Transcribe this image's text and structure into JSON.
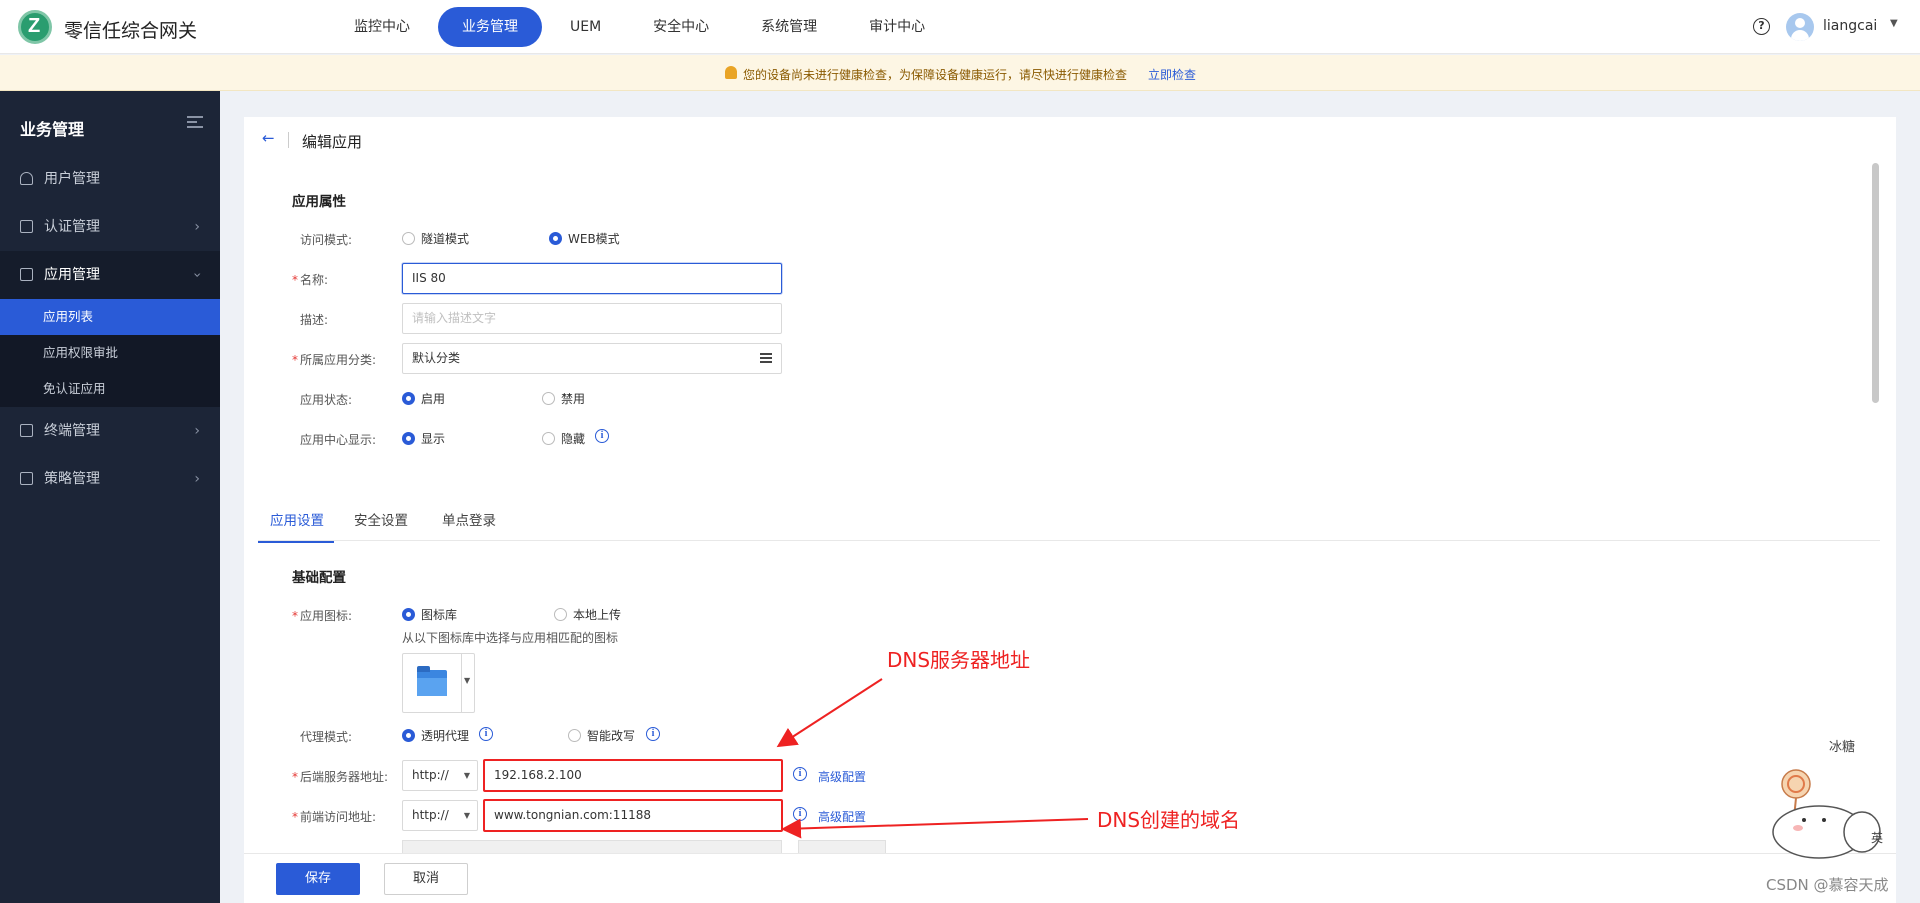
{
  "app": {
    "title": "零信任综合网关"
  },
  "nav": [
    "监控中心",
    "业务管理",
    "UEM",
    "安全中心",
    "系统管理",
    "审计中心"
  ],
  "user": {
    "name": "liangcai"
  },
  "notice": {
    "text": "您的设备尚未进行健康检查，为保障设备健康运行，请尽快进行健康检查",
    "link": "立即检查"
  },
  "sidebar": {
    "title": "业务管理",
    "items": [
      {
        "label": "用户管理"
      },
      {
        "label": "认证管理"
      },
      {
        "label": "应用管理"
      },
      {
        "label": "终端管理"
      },
      {
        "label": "策略管理"
      }
    ],
    "sub": [
      "应用列表",
      "应用权限审批",
      "免认证应用"
    ]
  },
  "page": {
    "title": "编辑应用"
  },
  "attrs": {
    "title": "应用属性",
    "access_mode": {
      "label": "访问模式:",
      "options": [
        "隧道模式",
        "WEB模式"
      ]
    },
    "name": {
      "label": "名称:",
      "value": "IIS 80"
    },
    "desc": {
      "label": "描述:",
      "placeholder": "请输入描述文字"
    },
    "category": {
      "label": "所属应用分类:",
      "value": "默认分类"
    },
    "status": {
      "label": "应用状态:",
      "options": [
        "启用",
        "禁用"
      ]
    },
    "display": {
      "label": "应用中心显示:",
      "options": [
        "显示",
        "隐藏"
      ]
    }
  },
  "tabs": [
    "应用设置",
    "安全设置",
    "单点登录"
  ],
  "basic": {
    "title": "基础配置",
    "icon": {
      "label": "应用图标:",
      "options": [
        "图标库",
        "本地上传"
      ],
      "hint": "从以下图标库中选择与应用相匹配的图标"
    },
    "proxy": {
      "label": "代理模式:",
      "options": [
        "透明代理",
        "智能改写"
      ]
    },
    "backend": {
      "label": "后端服务器地址:",
      "protocol": "http://",
      "value": "192.168.2.100",
      "link": "高级配置"
    },
    "frontend": {
      "label": "前端访问地址:",
      "protocol": "http://",
      "value": "www.tongnian.com:11188",
      "link": "高级配置"
    }
  },
  "buttons": {
    "save": "保存",
    "cancel": "取消"
  },
  "annotations": {
    "dns_server": "DNS服务器地址",
    "dns_domain": "DNS创建的域名"
  },
  "sticker": {
    "label": "冰糖",
    "tag": "英"
  },
  "watermark": "CSDN @慕容天成",
  "colors": {
    "accent": "#2a5bd7",
    "annotation": "#e22222",
    "sidebar": "#1c2537"
  }
}
